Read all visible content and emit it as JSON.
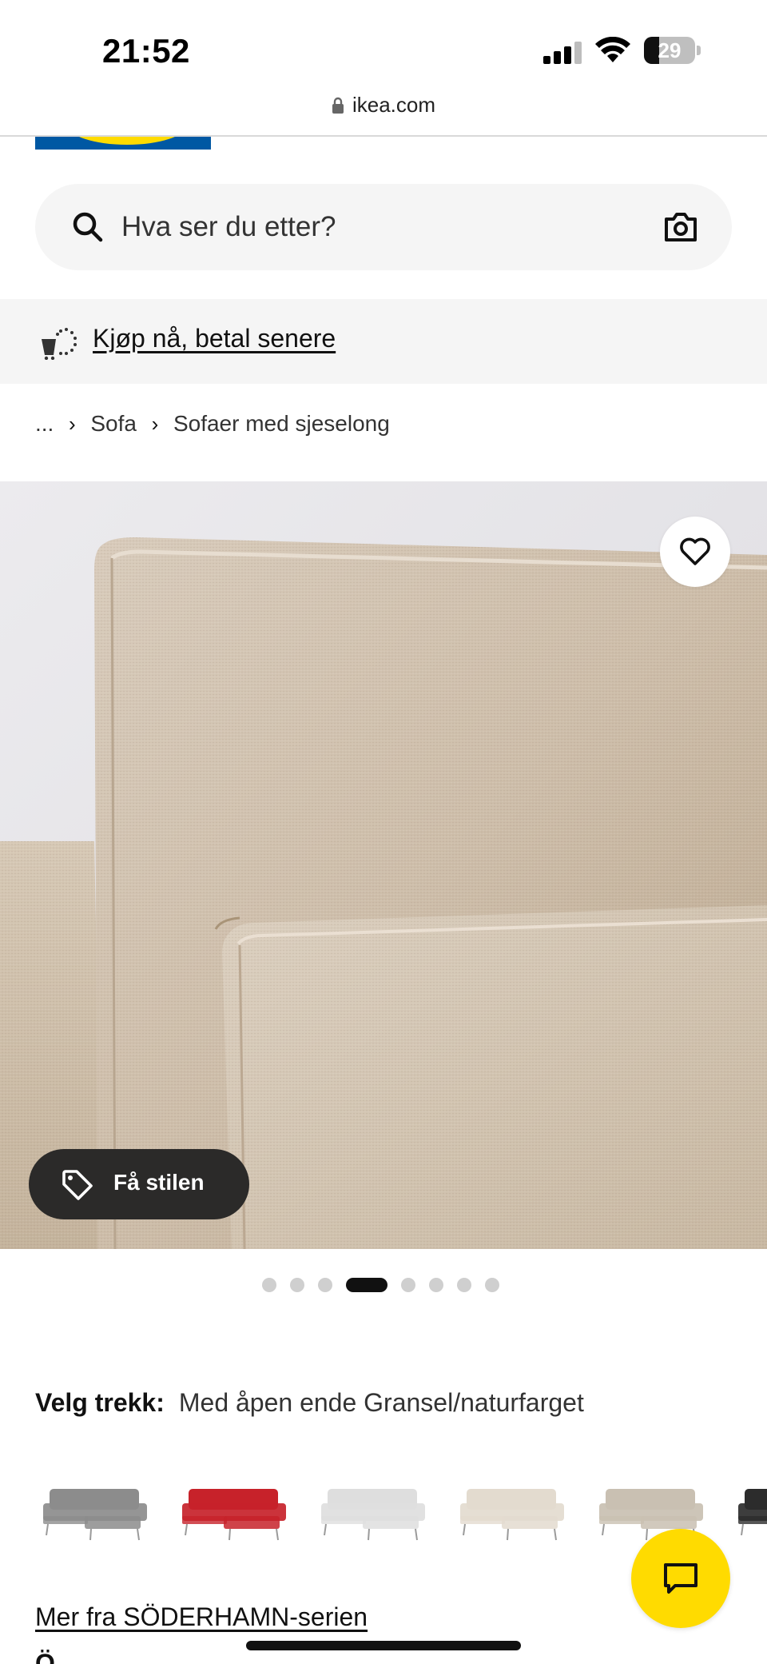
{
  "status_bar": {
    "time": "21:52",
    "battery_level": "29",
    "battery_fraction": 0.29,
    "icons": [
      "signal-icon",
      "wifi-icon",
      "battery-icon"
    ]
  },
  "browser": {
    "url": "ikea.com",
    "icons": [
      "lock-icon"
    ]
  },
  "brand": {
    "colors": {
      "blue": "#0058a3",
      "yellow": "#ffdb00"
    }
  },
  "search": {
    "placeholder": "Hva ser du etter?",
    "icons": [
      "search-icon",
      "camera-icon"
    ]
  },
  "promo": {
    "text": "Kjøp nå, betal senere",
    "icon": "installment-cart-icon"
  },
  "breadcrumb": {
    "items": [
      "...",
      "Sofa",
      "Sofaer med sjeselong"
    ]
  },
  "gallery": {
    "image_count": 8,
    "active_index": 4,
    "style_button": "Få stilen",
    "icons": [
      "heart-icon",
      "tag-icon"
    ]
  },
  "product": {
    "cover_label": "Velg trekk:",
    "cover_value": "Med åpen ende Gransel/naturfarget",
    "swatches": [
      {
        "color": "#8c8c8c"
      },
      {
        "color": "#c7222a"
      },
      {
        "color": "#dedede"
      },
      {
        "color": "#e3dbcf"
      },
      {
        "color": "#c9c0b2"
      },
      {
        "color": "#2c2c2c"
      }
    ],
    "series_link": "Mer fra SÖDERHAMN-serien",
    "next_heading_fragment": "Ö"
  },
  "chat": {
    "icon": "chat-icon"
  }
}
